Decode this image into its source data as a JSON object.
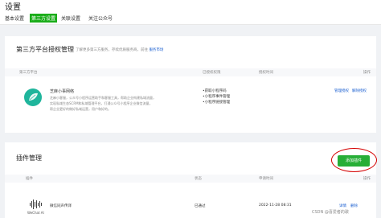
{
  "page": {
    "title": "设置"
  },
  "tabs": [
    {
      "label": "基本设置",
      "active": false
    },
    {
      "label": "第三方设置",
      "active": true
    },
    {
      "label": "关联设置",
      "active": false
    },
    {
      "label": "关注公众号",
      "active": false
    }
  ],
  "auth_section": {
    "title": "第三方平台授权管理",
    "desc_prefix": "了解更多第三方服务，存续优质服务商，前往",
    "desc_link": "服务市场",
    "columns": [
      "第三方平台",
      "已授权权限",
      "授权时间",
      "操作"
    ],
    "row": {
      "name": "芝麻小事网络",
      "desc_lines": [
        "芝麻小客服，公众号小程序运营助手和客服工具，帮助企业构建私域流量，",
        "实现私域生态SCRM和私域管理平台，打通公众号小程序企业微信流量，",
        "帮企业更好的做好私域运营，用户和好的。"
      ],
      "permissions": [
        "获取小程序码",
        "小程序事件管理",
        "小程序链接管理"
      ],
      "actions": [
        "管理授权",
        "解除授权"
      ]
    }
  },
  "plugin_section": {
    "title": "插件管理",
    "add_button": "添加插件",
    "columns": [
      "插件",
      "状态",
      "申请时间",
      "操作"
    ],
    "row": {
      "icon_label": "WeChat AI",
      "name": "微信同声传译",
      "status": "已通过",
      "time": "2022-11-28 08:31",
      "actions": [
        "详情",
        "删除"
      ]
    }
  },
  "watermark": "CSDN @喜爱者的歌",
  "colors": {
    "accent": "#1aad19",
    "link": "#1a5fd0",
    "highlight": "#d40000"
  }
}
